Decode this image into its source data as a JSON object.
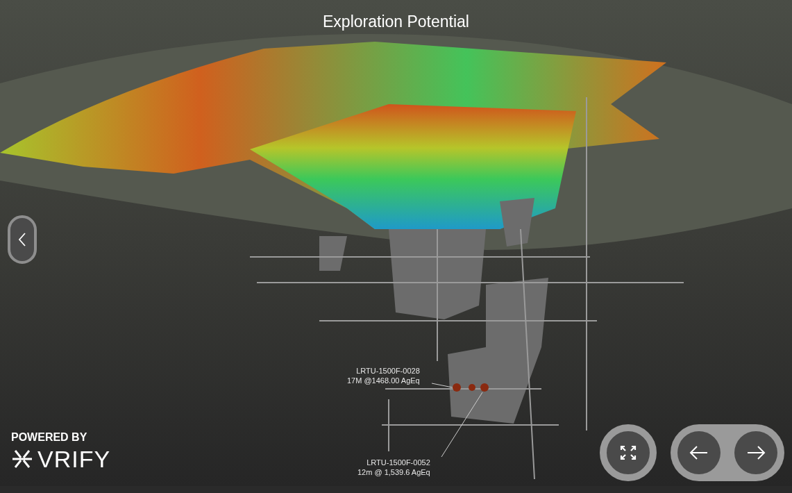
{
  "title": "Exploration Potential",
  "annotations": [
    {
      "line1": "LRTU-1500F-0028",
      "line2": "17M @1468.00 AgEq"
    },
    {
      "line1": "LRTU-1500F-0052",
      "line2": "12m @ 1,539.6 AgEq"
    }
  ],
  "branding": {
    "caption": "POWERED BY",
    "logo_text": "VRIFY"
  }
}
